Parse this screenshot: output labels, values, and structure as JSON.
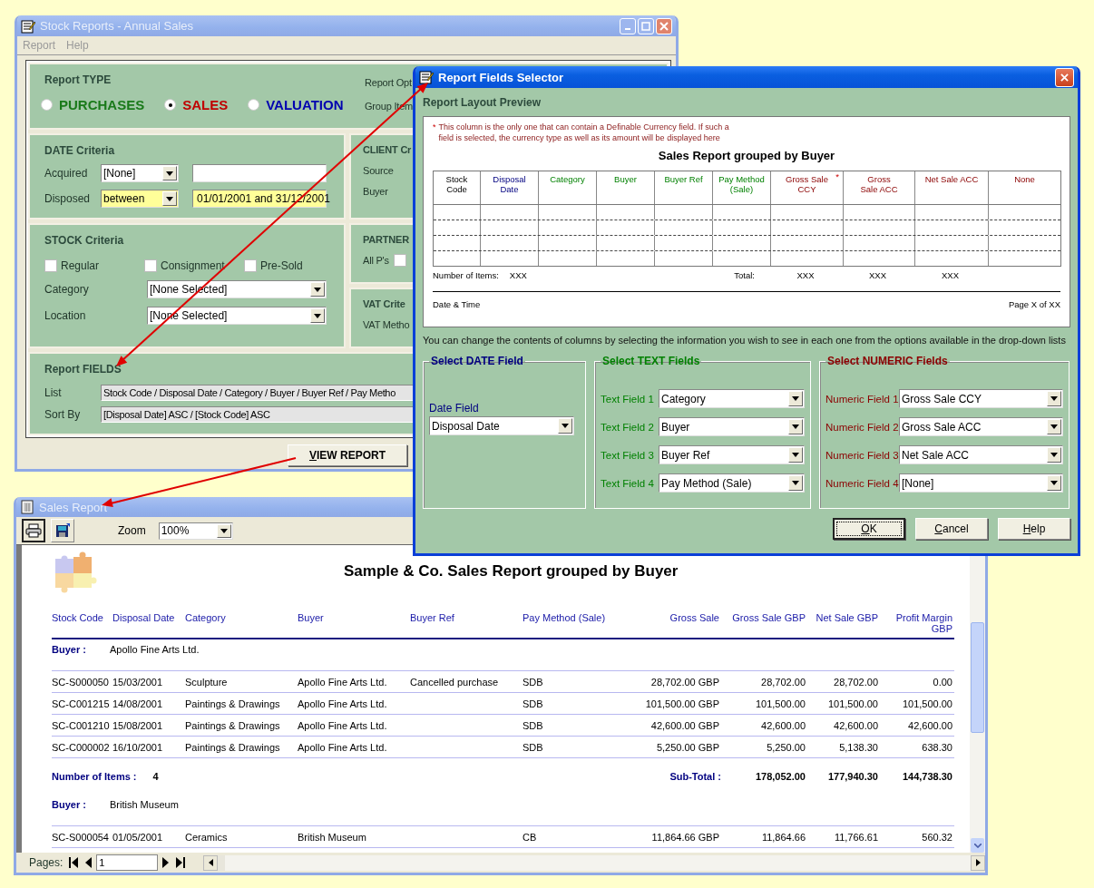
{
  "stock_reports": {
    "title": "Stock Reports - Annual Sales",
    "menu": [
      "Report",
      "Help"
    ],
    "report_type": {
      "heading": "Report TYPE",
      "options": [
        {
          "label": "PURCHASES",
          "selected": false,
          "color": "#1a7a1a"
        },
        {
          "label": "SALES",
          "selected": true,
          "color": "#c00000"
        },
        {
          "label": "VALUATION",
          "selected": false,
          "color": "#0000b0"
        }
      ],
      "side_labels": [
        "Report Opt",
        "Group Item"
      ]
    },
    "date_criteria": {
      "heading": "DATE Criteria",
      "rows": [
        {
          "label": "Acquired",
          "mode": "[None]",
          "highlighted": false
        },
        {
          "label": "Disposed",
          "mode": "between",
          "value": "01/01/2001 and 31/12/2001",
          "highlighted": true
        }
      ]
    },
    "client_criteria": {
      "heading": "CLIENT Cr",
      "labels": [
        "Source",
        "Buyer"
      ]
    },
    "stock_criteria": {
      "heading": "STOCK Criteria",
      "checkboxes": [
        {
          "label": "Regular",
          "checked": false
        },
        {
          "label": "Consignment",
          "checked": false
        },
        {
          "label": "Pre-Sold",
          "checked": false
        }
      ],
      "fields": [
        {
          "label": "Category",
          "value": "[None Selected]"
        },
        {
          "label": "Location",
          "value": "[None Selected]"
        }
      ]
    },
    "partner_criteria": {
      "heading": "PARTNER",
      "label": "All P's",
      "checked": false
    },
    "vat_criteria": {
      "heading": "VAT Crite",
      "label": "VAT Metho"
    },
    "report_fields": {
      "heading": "Report FIELDS",
      "rows": [
        {
          "label": "List",
          "value": "Stock Code / Disposal Date / Category / Buyer / Buyer Ref / Pay Metho"
        },
        {
          "label": "Sort By",
          "value": "[Disposal Date] ASC / [Stock Code] ASC"
        }
      ]
    },
    "view_button": "VIEW REPORT"
  },
  "fields_selector": {
    "title": "Report Fields Selector",
    "preview_heading": "Report Layout Preview",
    "note_mark": "*",
    "note": "This column is the only one that can contain a Definable Currency field. If such a field is selected, the currency type as well as its amount will be displayed here",
    "report_title": "Sales Report grouped by Buyer",
    "columns": [
      {
        "label": "Stock Code",
        "kind": "fixed"
      },
      {
        "label": "Disposal Date",
        "kind": "date"
      },
      {
        "label": "Category",
        "kind": "text"
      },
      {
        "label": "Buyer",
        "kind": "text"
      },
      {
        "label": "Buyer Ref",
        "kind": "text"
      },
      {
        "label": "Pay Method (Sale)",
        "kind": "text"
      },
      {
        "label": "Gross Sale CCY",
        "kind": "numeric",
        "mark": "*"
      },
      {
        "label": "Gross Sale ACC",
        "kind": "numeric"
      },
      {
        "label": "Net Sale ACC",
        "kind": "numeric"
      },
      {
        "label": "None",
        "kind": "numeric"
      }
    ],
    "items_label": "Number of Items:",
    "items_value": "XXX",
    "total_label": "Total:",
    "totals": [
      "XXX",
      "XXX",
      "XXX"
    ],
    "footer_left": "Date & Time",
    "footer_right": "Page X of XX",
    "instructions": "You can change the contents of columns by selecting the information you wish to see in each one from the options available in the drop-down lists",
    "date_group": {
      "heading": "Select DATE Field",
      "label": "Date Field",
      "value": "Disposal Date"
    },
    "text_group": {
      "heading": "Select TEXT Fields",
      "fields": [
        {
          "label": "Text Field 1",
          "value": "Category"
        },
        {
          "label": "Text Field 2",
          "value": "Buyer"
        },
        {
          "label": "Text Field 3",
          "value": "Buyer Ref"
        },
        {
          "label": "Text Field 4",
          "value": "Pay Method (Sale)"
        }
      ]
    },
    "numeric_group": {
      "heading": "Select NUMERIC Fields",
      "fields": [
        {
          "label": "Numeric Field 1",
          "value": "Gross Sale CCY"
        },
        {
          "label": "Numeric Field 2",
          "value": "Gross Sale ACC"
        },
        {
          "label": "Numeric Field 3",
          "value": "Net Sale ACC"
        },
        {
          "label": "Numeric Field 4",
          "value": "[None]"
        }
      ]
    },
    "buttons": [
      {
        "label": "OK",
        "focused": true
      },
      {
        "label": "Cancel",
        "focused": false
      },
      {
        "label": "Help",
        "focused": false
      }
    ]
  },
  "sales_report": {
    "title": "Sales Report",
    "zoom_label": "Zoom",
    "zoom": "100%",
    "report_title": "Sample & Co. Sales Report grouped by Buyer",
    "columns": [
      "Stock Code",
      "Disposal Date",
      "Category",
      "Buyer",
      "Buyer Ref",
      "Pay Method (Sale)",
      "Gross Sale",
      "Gross Sale GBP",
      "Net Sale GBP",
      "Profit Margin GBP"
    ],
    "groups": [
      {
        "label": "Buyer :",
        "name": "Apollo Fine Arts Ltd.",
        "rows": [
          {
            "stock_code": "SC-S000050",
            "disposal_date": "15/03/2001",
            "category": "Sculpture",
            "buyer": "Apollo Fine Arts Ltd.",
            "buyer_ref": "Cancelled purchase",
            "pay_method": "SDB",
            "gross_sale": "28,702.00 GBP",
            "gross_sale_gbp": "28,702.00",
            "net_sale_gbp": "28,702.00",
            "profit_margin_gbp": "0.00"
          },
          {
            "stock_code": "SC-C001215",
            "disposal_date": "14/08/2001",
            "category": "Paintings & Drawings",
            "buyer": "Apollo Fine Arts Ltd.",
            "pay_method": "SDB",
            "gross_sale": "101,500.00 GBP",
            "gross_sale_gbp": "101,500.00",
            "net_sale_gbp": "101,500.00",
            "profit_margin_gbp": "101,500.00"
          },
          {
            "stock_code": "SC-C001210",
            "disposal_date": "15/08/2001",
            "category": "Paintings & Drawings",
            "buyer": "Apollo Fine Arts Ltd.",
            "pay_method": "SDB",
            "gross_sale": "42,600.00 GBP",
            "gross_sale_gbp": "42,600.00",
            "net_sale_gbp": "42,600.00",
            "profit_margin_gbp": "42,600.00"
          },
          {
            "stock_code": "SC-C000002",
            "disposal_date": "16/10/2001",
            "category": "Paintings & Drawings",
            "buyer": "Apollo Fine Arts Ltd.",
            "pay_method": "SDB",
            "gross_sale": "5,250.00 GBP",
            "gross_sale_gbp": "5,250.00",
            "net_sale_gbp": "5,138.30",
            "profit_margin_gbp": "638.30"
          }
        ],
        "count_label": "Number of Items :",
        "count": "4",
        "subtotal_label": "Sub-Total :",
        "subtotals": [
          "178,052.00",
          "177,940.30",
          "144,738.30"
        ]
      },
      {
        "label": "Buyer :",
        "name": "British Museum",
        "rows": [
          {
            "stock_code": "SC-S000054",
            "disposal_date": "01/05/2001",
            "category": "Ceramics",
            "buyer": "British Museum",
            "pay_method": "CB",
            "gross_sale": "11,864.66 GBP",
            "gross_sale_gbp": "11,864.66",
            "net_sale_gbp": "11,766.61",
            "profit_margin_gbp": "560.32"
          }
        ]
      }
    ],
    "pages_label": "Pages:",
    "page": "1"
  }
}
